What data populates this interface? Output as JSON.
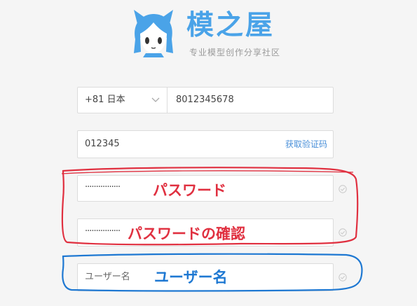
{
  "brand": {
    "name": "模之屋",
    "slogan": "专业模型创作分享社区",
    "color": "#4aa3e8"
  },
  "form": {
    "country_code": "+81 日本",
    "phone": "8012345678",
    "code": "012345",
    "get_code_label": "获取验证码",
    "password_mask": "················",
    "password_confirm_mask": "················",
    "username_placeholder": "ユーザー名"
  },
  "annotations": {
    "password": "パスワード",
    "password_confirm": "パスワードの確認",
    "username": "ユーザー名",
    "red_color": "#e03040",
    "blue_color": "#1e78d2"
  }
}
